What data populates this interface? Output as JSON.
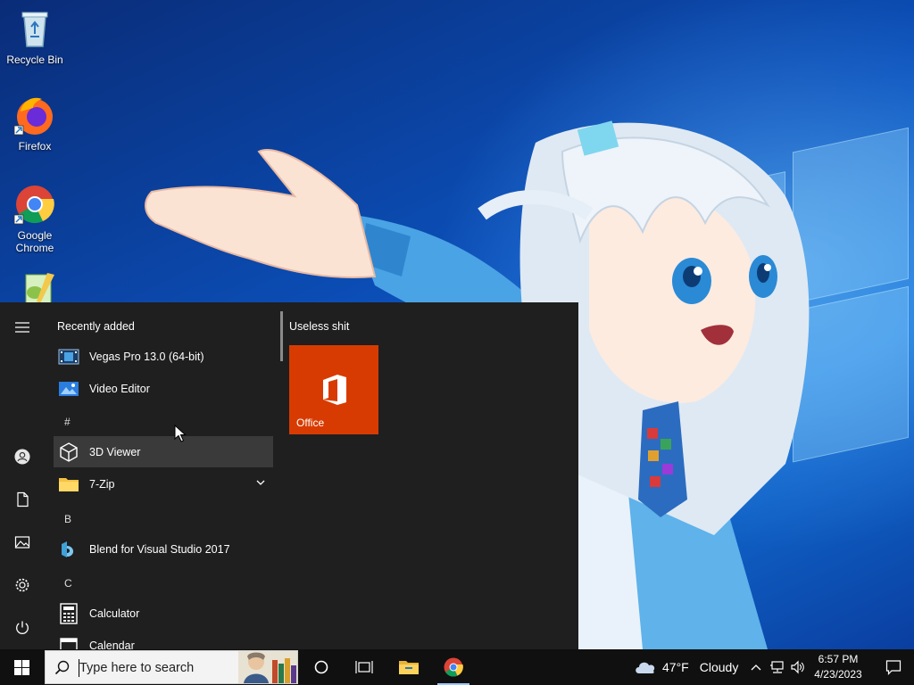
{
  "desktop": {
    "icons": [
      {
        "label": "Recycle Bin"
      },
      {
        "label": "Firefox"
      },
      {
        "label": "Google Chrome"
      }
    ]
  },
  "start_menu": {
    "recently_added_heading": "Recently added",
    "recent_apps": [
      {
        "label": "Vegas Pro 13.0 (64-bit)",
        "icon": "film-icon"
      },
      {
        "label": "Video Editor",
        "icon": "video-editor-icon"
      }
    ],
    "letters": [
      "#",
      "B",
      "C"
    ],
    "apps": [
      {
        "label": "3D Viewer",
        "icon": "cube-icon"
      },
      {
        "label": "7-Zip",
        "icon": "folder-icon"
      },
      {
        "label": "Blend for Visual Studio 2017",
        "icon": "blend-icon"
      },
      {
        "label": "Calculator",
        "icon": "calculator-icon"
      },
      {
        "label": "Calendar",
        "icon": "calendar-icon"
      }
    ],
    "tile_group": {
      "title": "Useless shit",
      "tiles": [
        {
          "label": "Office",
          "color": "#d83b01"
        }
      ]
    }
  },
  "taskbar": {
    "search_placeholder": "Type here to search",
    "weather": {
      "temp": "47°F",
      "condition": "Cloudy"
    },
    "clock": {
      "time": "6:57 PM",
      "date": "4/23/2023"
    }
  },
  "colors": {
    "start_bg": "#1f1f1f",
    "taskbar_bg": "#101010",
    "office_tile": "#d83b01",
    "hover_row": "#3a3a3a"
  }
}
